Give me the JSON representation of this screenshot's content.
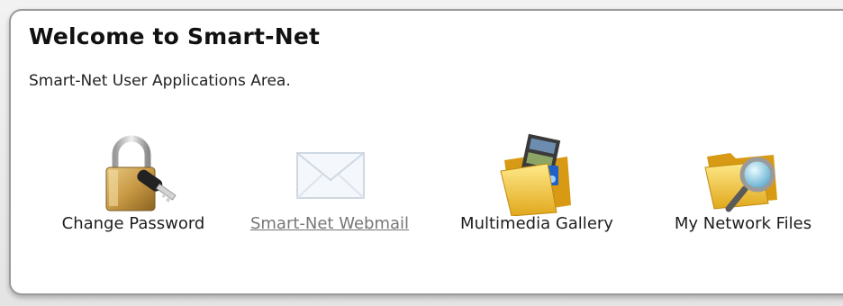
{
  "panel": {
    "title": "Welcome to Smart-Net",
    "subtitle": "Smart-Net User Applications Area."
  },
  "apps": [
    {
      "label": "Change Password",
      "icon": "padlock-key-icon"
    },
    {
      "label": "Smart-Net Webmail",
      "icon": "envelope-icon"
    },
    {
      "label": "Multimedia Gallery",
      "icon": "media-folder-icon"
    },
    {
      "label": "My Network Files",
      "icon": "folder-search-icon"
    }
  ]
}
